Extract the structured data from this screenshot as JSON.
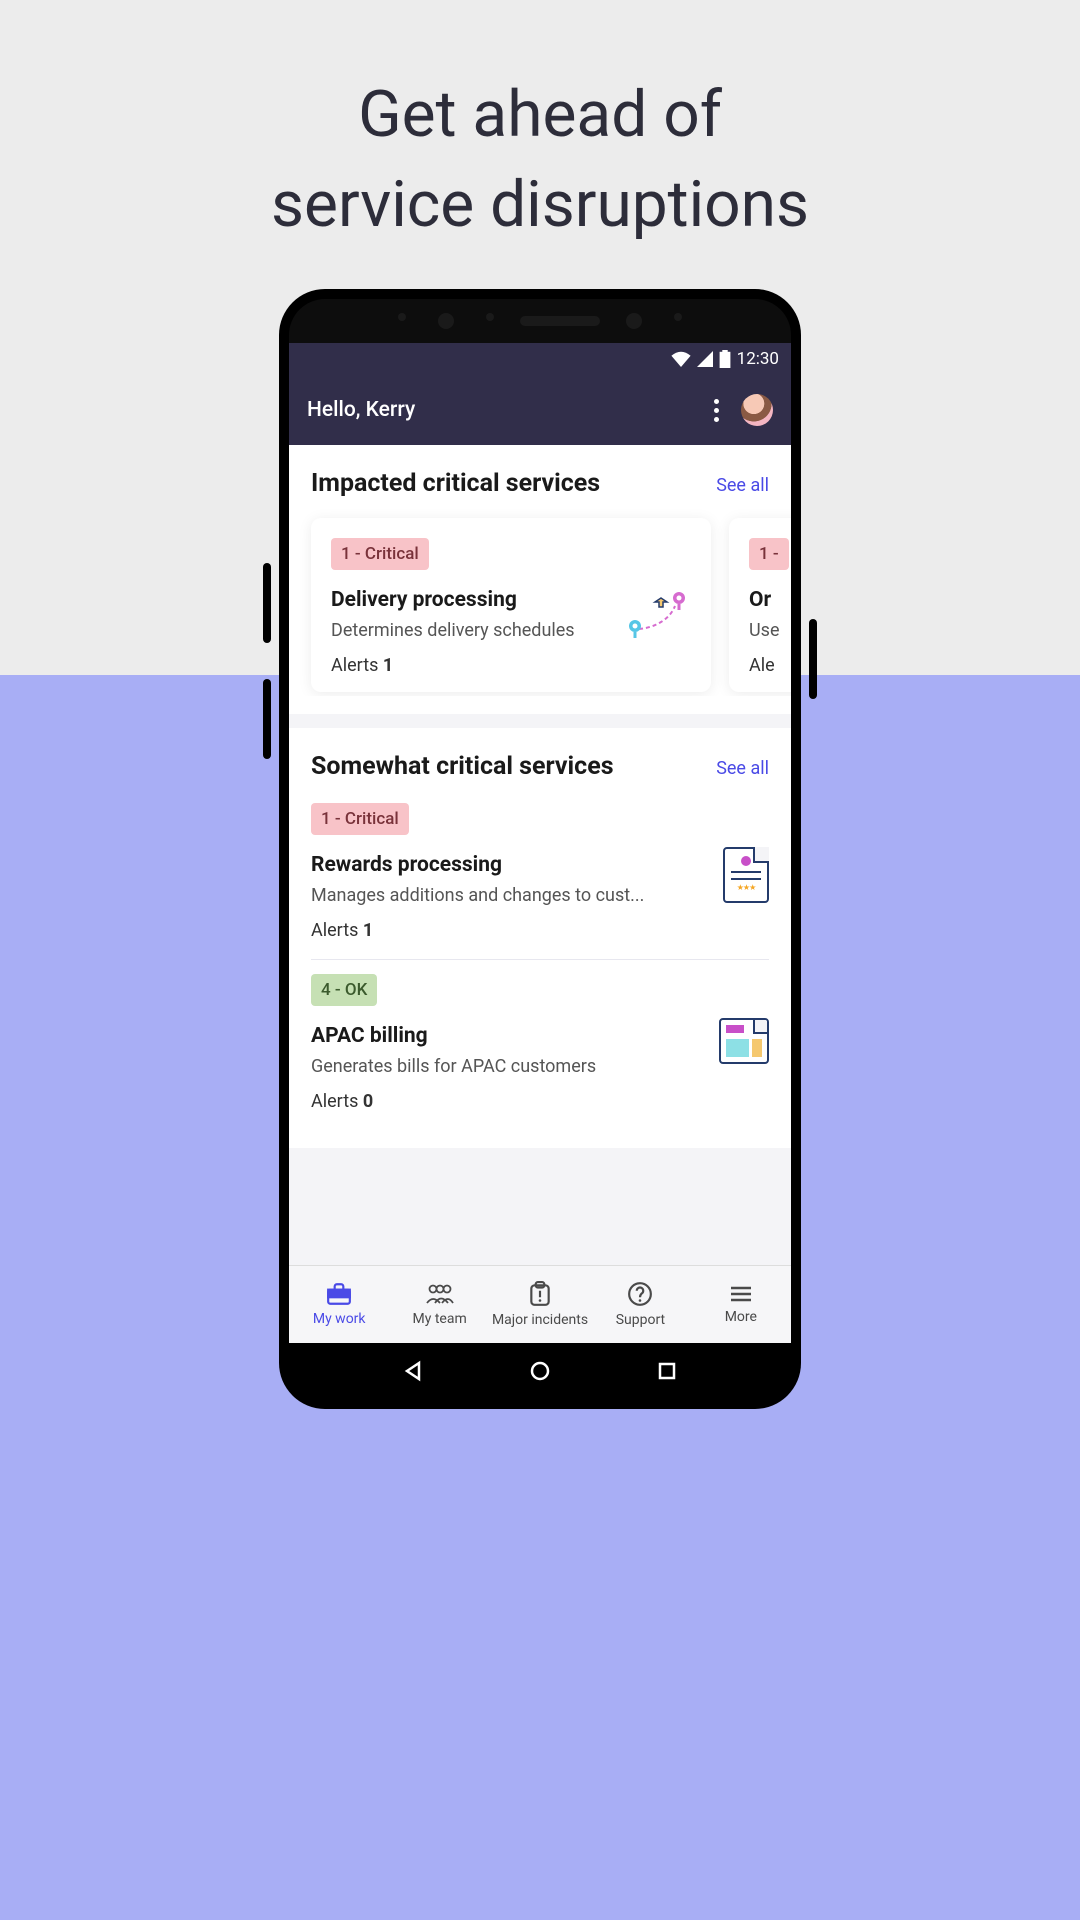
{
  "headline_line1": "Get ahead of",
  "headline_line2": "service disruptions",
  "status": {
    "time": "12:30"
  },
  "header": {
    "greeting": "Hello, Kerry"
  },
  "sections": {
    "impacted": {
      "title": "Impacted critical services",
      "see_all": "See all",
      "cards": [
        {
          "badge": "1 - Critical",
          "title": "Delivery processing",
          "desc": "Determines delivery schedules",
          "alerts_label": "Alerts",
          "alerts_count": "1"
        },
        {
          "badge": "1 -",
          "title": "Or",
          "desc": "Use",
          "alerts_label": "Ale",
          "alerts_count": ""
        }
      ]
    },
    "somewhat": {
      "title": "Somewhat critical services",
      "see_all": "See all",
      "items": [
        {
          "badge": "1 - Critical",
          "badge_type": "critical",
          "title": "Rewards processing",
          "desc": "Manages additions and changes to cust...",
          "alerts_label": "Alerts",
          "alerts_count": "1"
        },
        {
          "badge": "4 - OK",
          "badge_type": "ok",
          "title": "APAC billing",
          "desc": "Generates bills for APAC customers",
          "alerts_label": "Alerts",
          "alerts_count": "0"
        }
      ]
    }
  },
  "nav": {
    "mywork": "My work",
    "myteam": "My team",
    "major": "Major incidents",
    "support": "Support",
    "more": "More"
  }
}
